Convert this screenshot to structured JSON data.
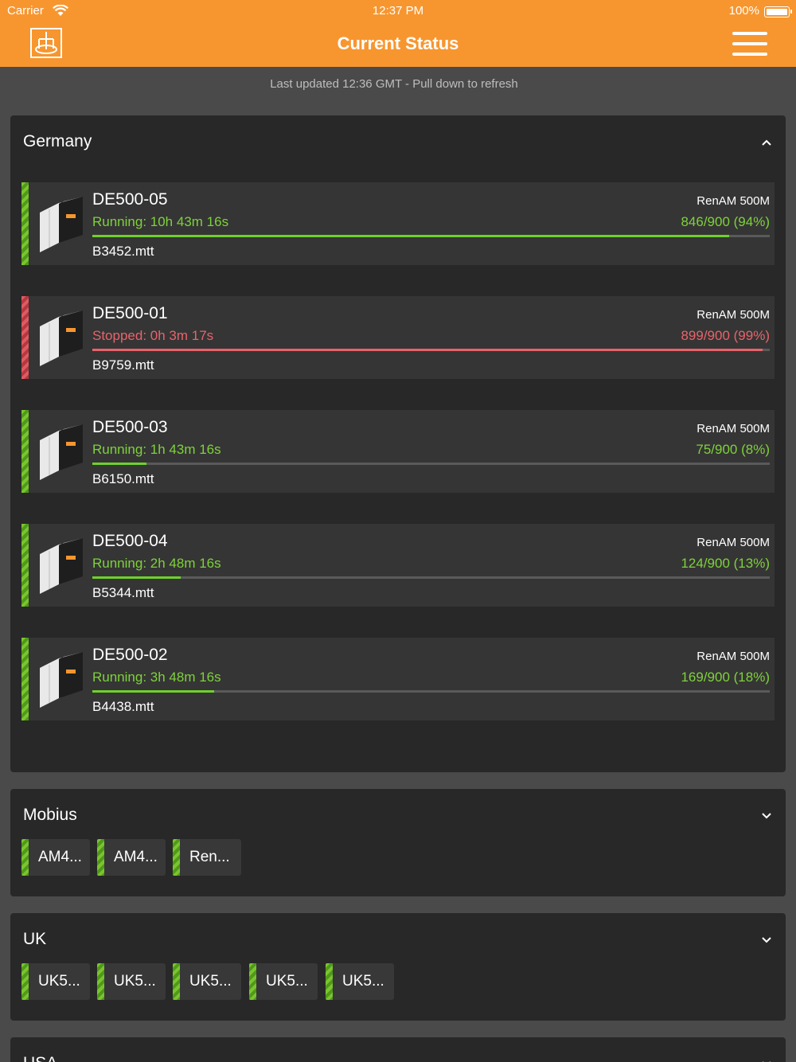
{
  "status_bar": {
    "carrier": "Carrier",
    "time": "12:37 PM",
    "battery": "100%"
  },
  "header": {
    "title": "Current Status"
  },
  "last_updated": "Last updated 12:36 GMT - Pull down to refresh",
  "sections": [
    {
      "title": "Germany",
      "expanded": true,
      "machines": [
        {
          "name": "DE500-05",
          "model": "RenAM 500M",
          "status": "Running: 10h 43m 16s",
          "progress_text": "846/900 (94%)",
          "progress_fraction": 0.94,
          "state": "running",
          "file": "B3452.mtt"
        },
        {
          "name": "DE500-01",
          "model": "RenAM 500M",
          "status": "Stopped: 0h 3m 17s",
          "progress_text": "899/900 (99%)",
          "progress_fraction": 0.99,
          "state": "stopped",
          "file": "B9759.mtt"
        },
        {
          "name": "DE500-03",
          "model": "RenAM 500M",
          "status": "Running: 1h 43m 16s",
          "progress_text": "75/900 (8%)",
          "progress_fraction": 0.08,
          "state": "running",
          "file": "B6150.mtt"
        },
        {
          "name": "DE500-04",
          "model": "RenAM 500M",
          "status": "Running: 2h 48m 16s",
          "progress_text": "124/900 (13%)",
          "progress_fraction": 0.13,
          "state": "running",
          "file": "B5344.mtt"
        },
        {
          "name": "DE500-02",
          "model": "RenAM 500M",
          "status": "Running: 3h 48m 16s",
          "progress_text": "169/900 (18%)",
          "progress_fraction": 0.18,
          "state": "running",
          "file": "B4438.mtt"
        }
      ]
    },
    {
      "title": "Mobius",
      "expanded": false,
      "chips": [
        "AM4...",
        "AM4...",
        "Ren..."
      ]
    },
    {
      "title": "UK",
      "expanded": false,
      "chips": [
        "UK5...",
        "UK5...",
        "UK5...",
        "UK5...",
        "UK5..."
      ]
    },
    {
      "title": "USA",
      "expanded": false
    }
  ],
  "colors": {
    "header": "#f7962f",
    "running": "#7ed23a",
    "stopped": "#e8636b",
    "background": "#4a4a4a",
    "panel": "#282828",
    "card": "#353535"
  },
  "icons": {
    "logo": "renishaw-logo-icon",
    "menu": "hamburger-menu-icon",
    "collapse": "chevron-up-icon",
    "expand": "chevron-down-icon",
    "machine": "printer-machine-icon"
  }
}
